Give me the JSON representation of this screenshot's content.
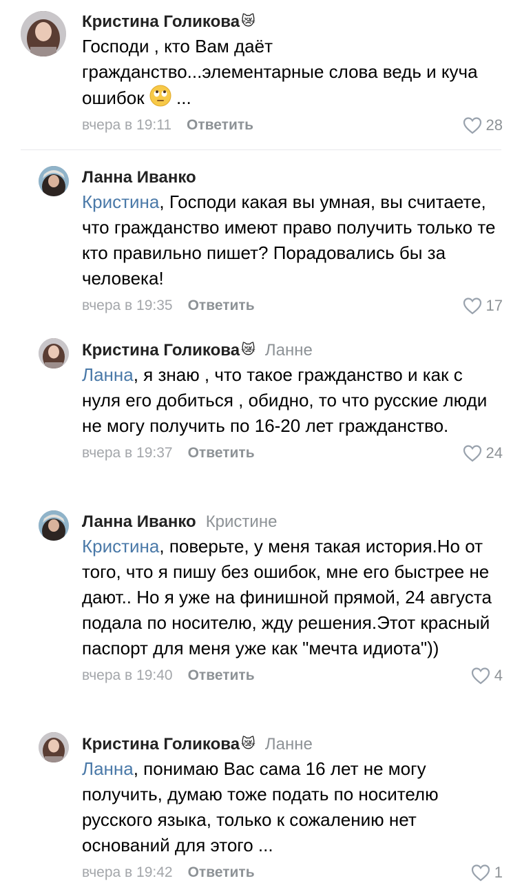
{
  "comments": [
    {
      "author": "Кристина Голикова",
      "reply_to": "",
      "mention": "",
      "text_before": "Господи , кто Вам даёт гражданство...элементарные слова ведь и куча ошибок",
      "text_after": " ...",
      "time": "вчера в 19:11",
      "reply_label": "Ответить",
      "likes": "28"
    },
    {
      "author": "Ланна Иванко",
      "reply_to": "",
      "mention": "Кристина",
      "text": ", Господи какая вы умная, вы считаете, что гражданство имеют право получить только те кто правильно пишет? Порадовались бы за человека!",
      "time": "вчера в 19:35",
      "reply_label": "Ответить",
      "likes": "17"
    },
    {
      "author": "Кристина Голикова",
      "reply_to": "Ланне",
      "mention": "Ланна",
      "text": ", я знаю , что такое гражданство и как с нуля его добиться , обидно, то что русские люди не могу получить по 16-20 лет гражданство.",
      "time": "вчера в 19:37",
      "reply_label": "Ответить",
      "likes": "24"
    },
    {
      "author": "Ланна Иванко",
      "reply_to": "Кристине",
      "mention": "Кристина",
      "text": ", поверьте, у меня такая история.Но от того, что я пишу без ошибок, мне его быстрее не дают.. Но  я уже на финишной прямой, 24 августа подала по носителю, жду решения.Этот красный паспорт для меня уже как \"мечта идиота\"))",
      "time": "вчера в 19:40",
      "reply_label": "Ответить",
      "likes": "4"
    },
    {
      "author": "Кристина Голикова",
      "reply_to": "Ланне",
      "mention": "Ланна",
      "text": ", понимаю Вас сама 16 лет не могу получить,  думаю тоже подать по носителю русского языка, только к сожалению нет оснований для этого ...",
      "time": "вчера в 19:42",
      "reply_label": "Ответить",
      "likes": "1"
    }
  ],
  "emoji": {
    "crying_cat": "😿",
    "eye_roll": "🙄"
  }
}
